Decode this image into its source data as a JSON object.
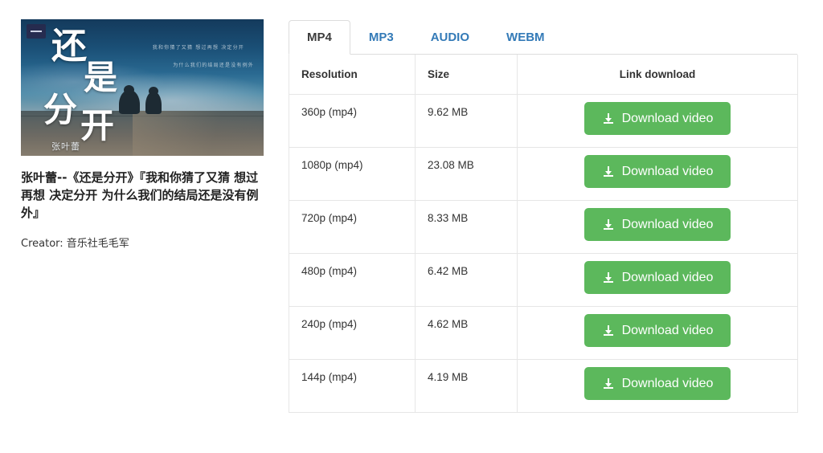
{
  "video": {
    "thumbnail": {
      "badge_icon": "minus-badge-icon",
      "title_chars": [
        "还",
        "是",
        "分",
        "开"
      ],
      "author_overlay": "张叶蕾",
      "poem_line_1": "我和你猜了又猜 想过再想 决定分开",
      "poem_line_2": "为什么我们的结局还是没有例外"
    },
    "title": "张叶蕾--《还是分开》『我和你猜了又猜 想过再想 决定分开 为什么我们的结局还是没有例外』",
    "creator": "Creator: 音乐社毛毛军"
  },
  "tabs": [
    {
      "label": "MP4",
      "active": true
    },
    {
      "label": "MP3",
      "active": false
    },
    {
      "label": "AUDIO",
      "active": false
    },
    {
      "label": "WEBM",
      "active": false
    }
  ],
  "table": {
    "headers": {
      "resolution": "Resolution",
      "size": "Size",
      "link": "Link download"
    },
    "rows": [
      {
        "resolution": "360p (mp4)",
        "size": "9.62 MB",
        "action": "Download video"
      },
      {
        "resolution": "1080p (mp4)",
        "size": "23.08 MB",
        "action": "Download video"
      },
      {
        "resolution": "720p (mp4)",
        "size": "8.33 MB",
        "action": "Download video"
      },
      {
        "resolution": "480p (mp4)",
        "size": "6.42 MB",
        "action": "Download video"
      },
      {
        "resolution": "240p (mp4)",
        "size": "4.62 MB",
        "action": "Download video"
      },
      {
        "resolution": "144p (mp4)",
        "size": "4.19 MB",
        "action": "Download video"
      }
    ]
  },
  "colors": {
    "link_blue": "#337ab7",
    "button_green": "#5cb85c",
    "border_gray": "#dddddd",
    "text_dark": "#333333"
  }
}
